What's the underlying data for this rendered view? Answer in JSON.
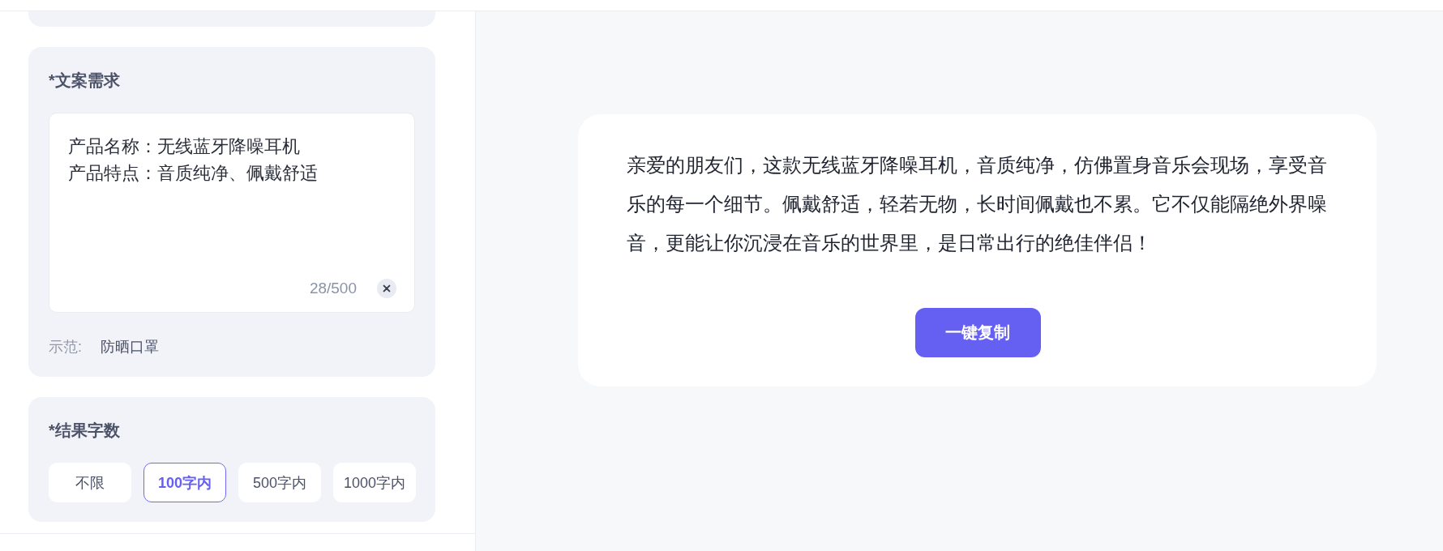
{
  "copy_request": {
    "title": "*文案需求",
    "value_lines": [
      "产品名称：无线蓝牙降噪耳机",
      "产品特点：音质纯净、佩戴舒适"
    ],
    "counter": "28/500",
    "example_label": "示范:",
    "examples": [
      "防晒口罩"
    ]
  },
  "result_length": {
    "title": "*结果字数",
    "options": [
      {
        "label": "不限",
        "selected": false
      },
      {
        "label": "100字内",
        "selected": true
      },
      {
        "label": "500字内",
        "selected": false
      },
      {
        "label": "1000字内",
        "selected": false
      }
    ]
  },
  "result": {
    "text": "亲爱的朋友们，这款无线蓝牙降噪耳机，音质纯净，仿佛置身音乐会现场，享受音乐的每一个细节。佩戴舒适，轻若无物，长时间佩戴也不累。它不仅能隔绝外界噪音，更能让你沉浸在音乐的世界里，是日常出行的绝佳伴侣！",
    "copy_button": "一键复制"
  }
}
